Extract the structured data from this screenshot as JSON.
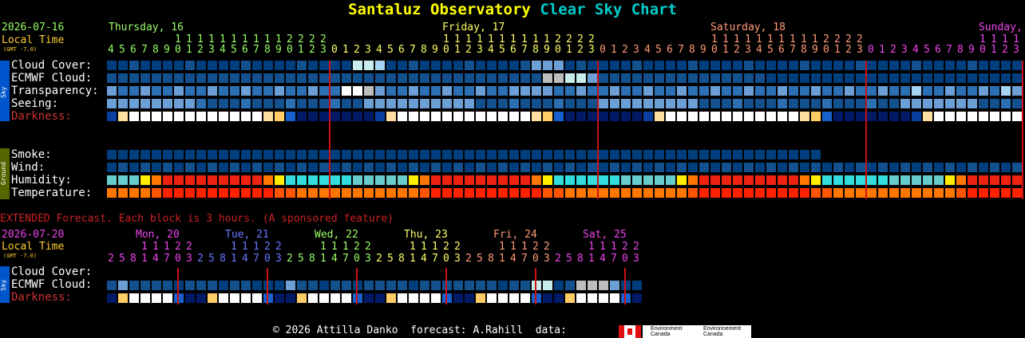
{
  "title": {
    "part1": "Santaluz Observatory",
    "part2": "Clear Sky Chart",
    "color1": "#ffff00",
    "color2": "#00cccc"
  },
  "header": {
    "date": "2026-07-16",
    "local_time": "Local Time",
    "gmt": "(GMT -7.0)",
    "days": [
      {
        "label": "Thursday, 16",
        "color": "#99ff66"
      },
      {
        "label": "Friday, 17",
        "color": "#ffff66"
      },
      {
        "label": "Saturday, 18",
        "color": "#ff9977"
      },
      {
        "label": "Sunday, 19",
        "color": "#ee44ee"
      }
    ]
  },
  "hours_first": [
    4,
    5,
    6,
    7,
    8,
    9,
    10,
    11,
    12,
    13
  ],
  "labels": {
    "cloud": "Cloud Cover:",
    "ecmwf": "ECMWF Cloud:",
    "transparency": "Transparency:",
    "seeing": "Seeing:",
    "darkness": "Darkness:",
    "smoke": "Smoke:",
    "wind": "Wind:",
    "humidity": "Humidity:",
    "temperature": "Temperature:"
  },
  "sidebar": {
    "sky": "Sky",
    "ground": "Ground"
  },
  "extended": {
    "banner": "EXTENDED Forecast. Each block is 3 hours. (A sponsored feature)",
    "date": "2026-07-20",
    "local_time": "Local Time",
    "gmt": "(GMT -7.0)",
    "days": [
      {
        "label": "Mon, 20",
        "color": "#ee44ee"
      },
      {
        "label": "Tue, 21",
        "color": "#6677ff"
      },
      {
        "label": "Wed, 22",
        "color": "#99ff66"
      },
      {
        "label": "Thu, 23",
        "color": "#ffff66"
      },
      {
        "label": "Fri, 24",
        "color": "#ff9977"
      },
      {
        "label": "Sat, 25",
        "color": "#ee44ee"
      }
    ],
    "hours": [
      2,
      5,
      8,
      11,
      14,
      17,
      20,
      23
    ],
    "labels": {
      "cloud": "Cloud Cover:",
      "ecmwf": "ECMWF Cloud:",
      "darkness": "Darkness:"
    }
  },
  "footer": {
    "text": "© 2026 Attilla Danko  forecast: A.Rahill  data:",
    "logo1": "Environment Canada",
    "logo2": "Environnement Canada"
  },
  "colors": {
    "clear": "#003e7e",
    "mostly_clear": "#13508e",
    "light_blue": "#2c6fb3",
    "sky": "#6b9fd6",
    "pale": "#a7d3f3",
    "very_pale": "#c8ecec",
    "grey": "#bebebe",
    "white": "#ffffff",
    "smoke": "#003e7e",
    "hum_cyan": "#33dddd",
    "hum_teal": "#66cccc",
    "hum_green": "#99ee99",
    "hum_yellow": "#ffee00",
    "hum_orange": "#ff7700",
    "hum_red": "#ee2211",
    "temp_red": "#ff2200",
    "temp_orange": "#ff7700",
    "temp_dorange": "#ff5500"
  }
}
